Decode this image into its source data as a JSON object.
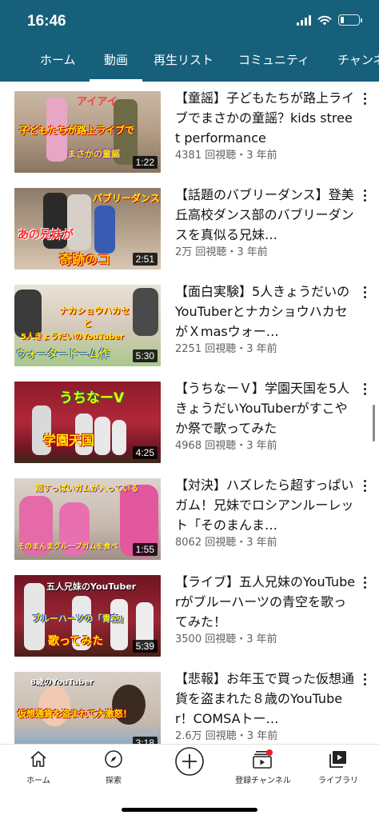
{
  "status": {
    "time": "16:46",
    "battery_level": 0.2
  },
  "tabs": [
    "ホーム",
    "動画",
    "再生リスト",
    "コミュニティ",
    "チャンネル"
  ],
  "active_tab": "動画",
  "videos": [
    {
      "title": "【童謡】子どもたちが路上ライブでまさかの童謡？kids street performance",
      "meta": "4381 回視聴・3 年前",
      "duration": "1:22",
      "thumb_texts": [
        "アイアイ",
        "子どもたちが路上ライブで",
        "まさかの童謡"
      ]
    },
    {
      "title": "【話題のバブリーダンス】登美丘高校ダンス部のバブリーダンスを真似る兄妹…",
      "meta": "2万 回視聴・3 年前",
      "duration": "2:51",
      "thumb_texts": [
        "バブリーダンス",
        "あの兄妹が",
        "奇跡のコ"
      ]
    },
    {
      "title": "【面白実験】5人きょうだいのYouTuberとナカショウハカセがＸmasウォー…",
      "meta": "2251 回視聴・3 年前",
      "duration": "5:30",
      "thumb_texts": [
        "ナカショウハカセ",
        "と",
        "5人きょうだいのYouTuber",
        "ウォータードーム作"
      ]
    },
    {
      "title": "【うちなーＶ】学園天国を5人きょうだいYouTuberがすこやか祭で歌ってみた",
      "meta": "4968 回視聴・3 年前",
      "duration": "4:25",
      "thumb_texts": [
        "うちなーV",
        "学園天国"
      ]
    },
    {
      "title": "【対決】ハズレたら超すっぱいガム！兄妹でロシアンルーレット「そのまんま…",
      "meta": "8062 回視聴・3 年前",
      "duration": "1:55",
      "thumb_texts": [
        "超すっぱいガムが入っている",
        "そのまんまグループガムを食べ"
      ]
    },
    {
      "title": "【ライブ】五人兄妹のYouTuberがブルーハーツの青空を歌ってみた！",
      "meta": "3500 回視聴・3 年前",
      "duration": "5:39",
      "thumb_texts": [
        "五人兄妹のYouTuber",
        "ブルーハーツの「青空」",
        "歌ってみた"
      ]
    },
    {
      "title": "【悲報】お年玉で買った仮想通貨を盗まれた８歳のYouTuber！COMSAトー…",
      "meta": "2.6万 回視聴・3 年前",
      "duration": "3:18",
      "thumb_texts": [
        "8歳のYouTuber",
        "仮想通貨を盗まれて大激怒！"
      ]
    }
  ],
  "bottom_nav": [
    {
      "label": "ホーム",
      "icon": "home-icon"
    },
    {
      "label": "探索",
      "icon": "compass-icon"
    },
    {
      "label": "",
      "icon": "create-plus-icon"
    },
    {
      "label": "登録チャンネル",
      "icon": "subscriptions-icon"
    },
    {
      "label": "ライブラリ",
      "icon": "library-icon"
    }
  ],
  "colors": {
    "header": "#17607c",
    "notification_dot": "#ee1c25"
  }
}
